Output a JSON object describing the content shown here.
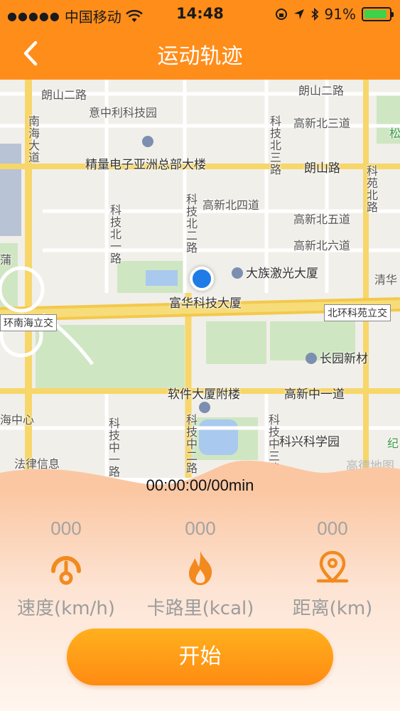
{
  "status_bar": {
    "carrier": "中国移动",
    "time": "14:48",
    "battery": "91%",
    "battery_level": 0.91
  },
  "nav": {
    "title": "运动轨迹"
  },
  "map": {
    "labels": {
      "langshan2_left": "朗山二路",
      "langshan2_right": "朗山二路",
      "yizhongli": "意中利科技园",
      "gaoxin_bei3": "高新北三道",
      "nanhai": "南海大道",
      "keji_bei3": "科技北三路",
      "jingliang": "精量电子亚洲总部大楼",
      "langshan": "朗山路",
      "keyuan_bei": "科苑北路",
      "gaoxin_bei4": "高新北四道",
      "gaoxin_bei5": "高新北五道",
      "keji_bei1": "科技北一路",
      "keji_bei2": "科技北二路",
      "gaoxin_bei6": "高新北六道",
      "daheng": "大族激光大厦",
      "qinghua": "清华",
      "fuhua": "富华科技大厦",
      "huannan_tag": "环南海立交",
      "beihuan_tag": "北环科苑立交",
      "changyuan": "长园新材",
      "ruanjian": "软件大厦附楼",
      "gaoxin_zhong1": "高新中一道",
      "hai_zhongxin": "海中心",
      "keji_zhong1": "科技中一路",
      "keji_zhong2": "科技中二路",
      "keji_zhong3": "科技中三路",
      "kexing": "科兴科学园",
      "falv": "法律信息",
      "ji": "纪",
      "jiang": "蒲",
      "song": "松",
      "brand": "高德地图"
    }
  },
  "timer": "00:00:00/00min",
  "stats": [
    {
      "value": "000",
      "label": "速度(km/h)",
      "icon": "speedometer-icon"
    },
    {
      "value": "000",
      "label": "卡路里(kcal)",
      "icon": "flame-icon"
    },
    {
      "value": "000",
      "label": "距离(km)",
      "icon": "location-pin-icon"
    }
  ],
  "start_button": "开始",
  "colors": {
    "accent": "#ff8d1a",
    "button_top": "#ffb01e",
    "button_bottom": "#ff8b12",
    "location_dot": "#1f7be6"
  }
}
